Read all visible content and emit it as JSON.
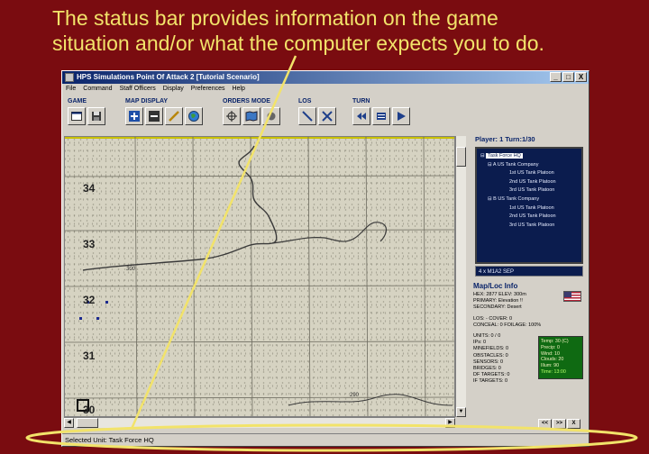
{
  "caption": {
    "line1": "The status bar provides information on the game",
    "line2": "situation and/or what the computer expects you to do."
  },
  "window": {
    "title": "HPS Simulations Point Of Attack 2 [Tutorial Scenario]",
    "controls": [
      "_",
      "□",
      "X"
    ]
  },
  "menu": [
    "File",
    "Command",
    "Staff Officers",
    "Display",
    "Preferences",
    "Help"
  ],
  "toolbar": {
    "groups": [
      {
        "label": "GAME",
        "buttons": [
          "window-icon",
          "save-icon"
        ]
      },
      {
        "label": "MAP DISPLAY",
        "buttons": [
          "zoom-in-icon",
          "zoom-out-icon",
          "edit-icon",
          "globe-icon"
        ]
      },
      {
        "label": "ORDERS MODE",
        "buttons": [
          "crosshair-icon",
          "map-icon",
          "record-icon"
        ]
      },
      {
        "label": "LOS",
        "buttons": [
          "los-line-icon",
          "los-clear-icon"
        ]
      },
      {
        "label": "TURN",
        "buttons": [
          "rewind-icon",
          "panel-icon",
          "play-icon"
        ]
      }
    ]
  },
  "map": {
    "hex_rows": [
      "34",
      "33",
      "32",
      "31",
      "30"
    ],
    "contour_labels": [
      "300",
      "290"
    ]
  },
  "side": {
    "player_info": "Player: 1   Turn:1/30",
    "oob": [
      {
        "label": "Task Force HQ",
        "indent": 0,
        "prefix": "⊟"
      },
      {
        "label": "A  US Tank Company",
        "indent": 1,
        "prefix": "⊟"
      },
      {
        "label": "1st US Tank Platoon",
        "indent": 2,
        "prefix": ""
      },
      {
        "label": "2nd US Tank Platoon",
        "indent": 2,
        "prefix": ""
      },
      {
        "label": "3rd US Tank Platoon",
        "indent": 2,
        "prefix": ""
      },
      {
        "label": "B  US Tank Company",
        "indent": 1,
        "prefix": "⊟"
      },
      {
        "label": "1st US Tank Platoon",
        "indent": 2,
        "prefix": ""
      },
      {
        "label": "2nd US Tank Platoon",
        "indent": 2,
        "prefix": ""
      },
      {
        "label": "3rd US Tank Platoon",
        "indent": 2,
        "prefix": ""
      }
    ],
    "unit_selection": "4 x M1A2 SEP",
    "map_loc_title": "Map/Loc Info",
    "loc_lines": [
      "HEX: 2877          ELEV: 300m",
      "PRIMARY: Elevation !!",
      "SECONDARY: Desert",
      "",
      "LOS: -                    COVER: 0",
      "CONCEAL: 0           FOILAGE: 100%",
      "",
      "UNITS: 0 / 0",
      "IPs: 0",
      "MINEFIELDS: 0",
      "OBSTACLES: 0",
      "SENSORS: 0",
      "BRIDGES: 0",
      "DF TARGETS: 0",
      "IF TARGETS: 0"
    ],
    "weather": [
      "Temp: 30 (C)",
      "Precip: 0",
      "Wind: 10",
      "Clouds: 20",
      "Illum: 90"
    ],
    "time": "Time: 13:00",
    "nav_buttons": [
      "<<",
      ">>",
      "X"
    ]
  },
  "statusbar": {
    "text": "Selected Unit: Task Force HQ"
  },
  "colors": {
    "background": "#7a0c10",
    "caption": "#f2e36a",
    "highlight": "#f2e36a"
  }
}
